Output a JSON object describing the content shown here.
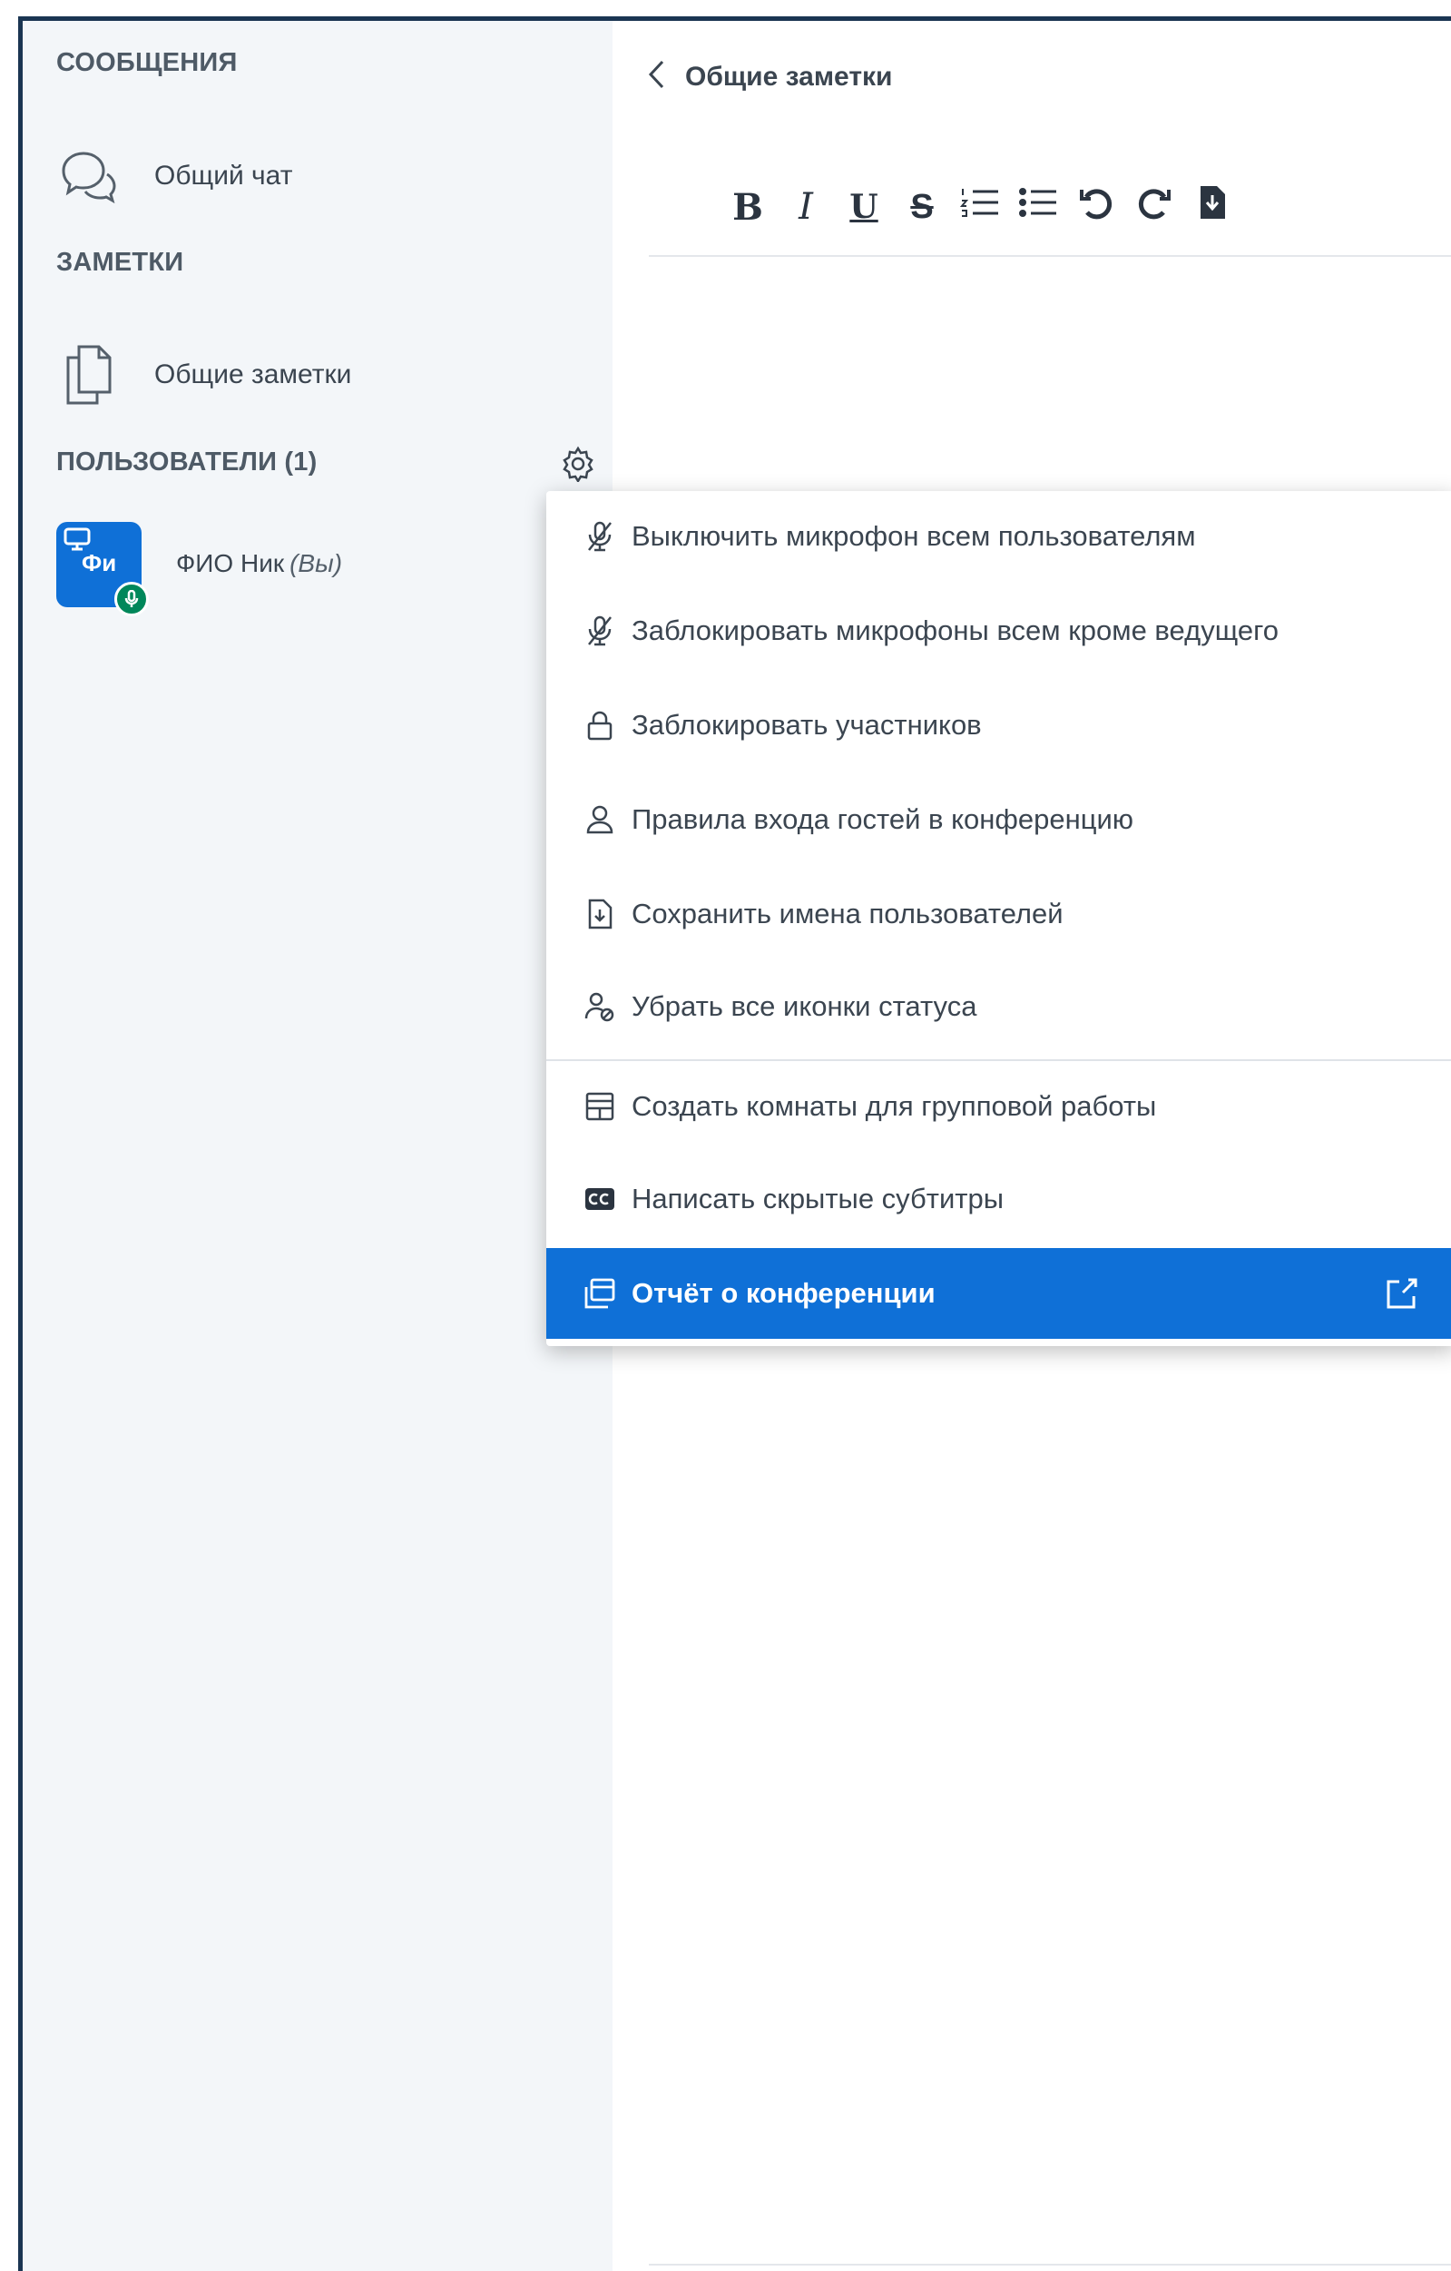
{
  "sidebar": {
    "messages_title": "СООБЩЕНИЯ",
    "chat_label": "Общий чат",
    "notes_title": "ЗАМЕТКИ",
    "notes_label": "Общие заметки",
    "users_title": "ПОЛЬЗОВАТЕЛИ (1)",
    "user": {
      "initials": "Фи",
      "name": "ФИО Ник",
      "you": "(Вы)"
    }
  },
  "notes_panel": {
    "title": "Общие заметки",
    "toolbar": {
      "bold": "B",
      "italic": "I",
      "underline": "U",
      "strike": "S"
    }
  },
  "menu": {
    "items": [
      {
        "label": "Выключить микрофон всем пользователям",
        "icon": "mic-off-icon"
      },
      {
        "label": "Заблокировать микрофоны всем кроме ведущего",
        "icon": "mic-off-icon"
      },
      {
        "label": "Заблокировать участников",
        "icon": "lock-icon"
      },
      {
        "label": "Правила входа гостей в конференцию",
        "icon": "user-icon"
      },
      {
        "label": "Сохранить имена пользователей",
        "icon": "download-file-icon"
      },
      {
        "label": "Убрать все иконки статуса",
        "icon": "clear-status-icon"
      },
      {
        "label": "Создать комнаты для групповой работы",
        "icon": "rooms-icon"
      },
      {
        "label": "Написать скрытые субтитры",
        "icon": "closed-captions-icon"
      },
      {
        "label": "Отчёт о конференции",
        "icon": "report-icon",
        "active": true
      }
    ]
  },
  "colors": {
    "accent": "#0f70d7",
    "sidebar_bg": "#f3f6f9",
    "status_green": "#00875a",
    "frame_border": "#1a3552"
  }
}
